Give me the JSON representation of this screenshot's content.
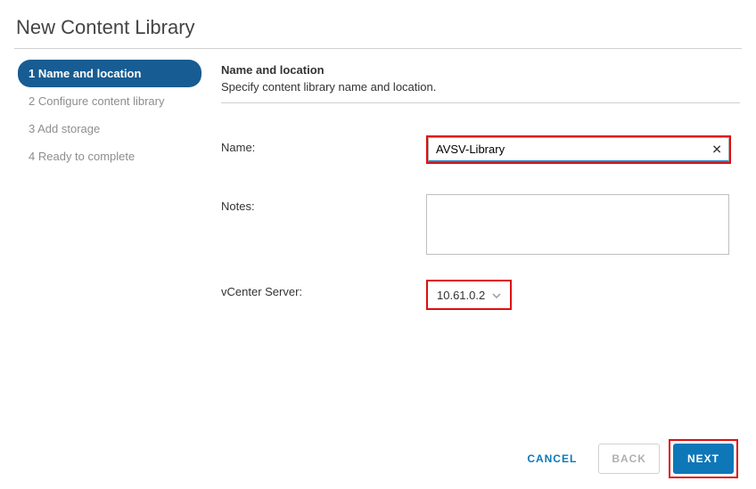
{
  "dialog": {
    "title": "New Content Library"
  },
  "steps": [
    {
      "num": "1",
      "label": "Name and location",
      "state": "active"
    },
    {
      "num": "2",
      "label": "Configure content library",
      "state": "future"
    },
    {
      "num": "3",
      "label": "Add storage",
      "state": "future"
    },
    {
      "num": "4",
      "label": "Ready to complete",
      "state": "future"
    }
  ],
  "section": {
    "title": "Name and location",
    "subtitle": "Specify content library name and location."
  },
  "form": {
    "name_label": "Name:",
    "name_value": "AVSV-Library",
    "notes_label": "Notes:",
    "notes_value": "",
    "server_label": "vCenter Server:",
    "server_value": "10.61.0.2"
  },
  "footer": {
    "cancel": "CANCEL",
    "back": "BACK",
    "next": "NEXT"
  }
}
